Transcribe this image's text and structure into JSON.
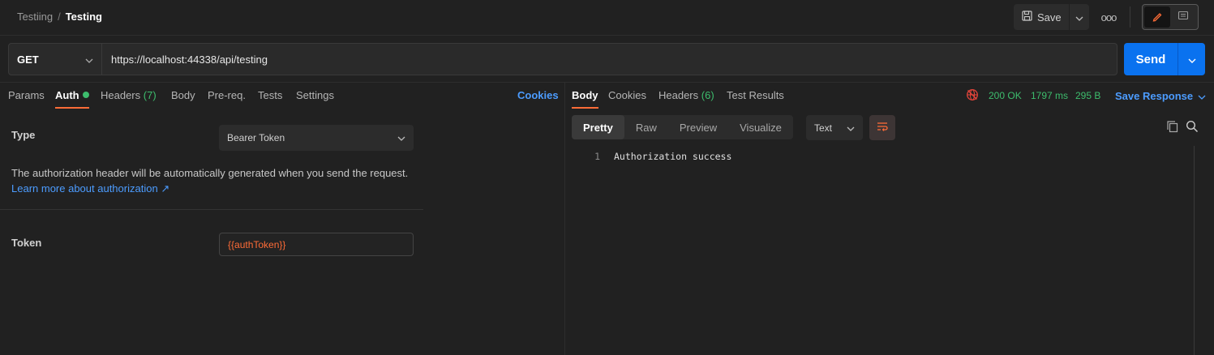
{
  "breadcrumb": {
    "parent": "Testiing",
    "separator": "/",
    "current": "Testing"
  },
  "header": {
    "save_label": "Save",
    "more_label": "ooo"
  },
  "request": {
    "method": "GET",
    "url": "https://localhost:44338/api/testing",
    "send_label": "Send"
  },
  "request_tabs": [
    {
      "label": "Params"
    },
    {
      "label": "Auth",
      "active": true,
      "indicator": "green-dot"
    },
    {
      "label": "Headers",
      "count": "(7)"
    },
    {
      "label": "Body"
    },
    {
      "label": "Pre-req."
    },
    {
      "label": "Tests"
    },
    {
      "label": "Settings"
    }
  ],
  "cookies_link": "Cookies",
  "auth": {
    "type_label": "Type",
    "type_value": "Bearer Token",
    "description": "The authorization header will be automatically generated when you send the request.",
    "learn_more": "Learn more about authorization",
    "learn_more_arrow": "↗",
    "token_label": "Token",
    "token_value": "{{authToken}}"
  },
  "response_tabs": [
    {
      "label": "Body",
      "active": true
    },
    {
      "label": "Cookies"
    },
    {
      "label": "Headers",
      "count": "(6)"
    },
    {
      "label": "Test Results"
    }
  ],
  "response_status": {
    "code": "200 OK",
    "time": "1797 ms",
    "size": "295 B",
    "save_response": "Save Response"
  },
  "format_tabs": [
    {
      "label": "Pretty",
      "active": true
    },
    {
      "label": "Raw"
    },
    {
      "label": "Preview"
    },
    {
      "label": "Visualize"
    }
  ],
  "format_select": "Text",
  "response_body": [
    {
      "line": "1",
      "text": "Authorization success"
    }
  ],
  "colors": {
    "accent_orange": "#ff6c37",
    "send_blue": "#0a72ef",
    "link_blue": "#4c9cff",
    "success_green": "#3dbd6d",
    "background": "#212121"
  },
  "icons": [
    "save-icon",
    "chevron-down-icon",
    "more-icon",
    "edit-icon",
    "comment-icon",
    "globe-error-icon",
    "wrap-lines-icon",
    "copy-icon",
    "search-icon"
  ]
}
